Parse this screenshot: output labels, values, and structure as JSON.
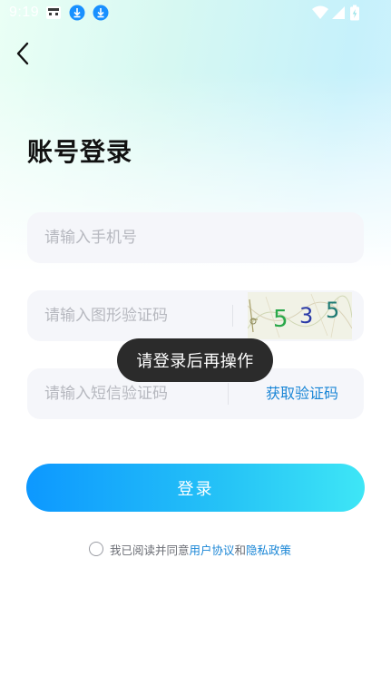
{
  "status_bar": {
    "time": "9:19",
    "icons": [
      "app-badge-icon",
      "download-icon",
      "download-icon",
      "wifi-icon",
      "cellular-signal-icon",
      "battery-icon"
    ]
  },
  "header": {
    "back_icon": "chevron-left-icon"
  },
  "page": {
    "title": "账号登录"
  },
  "form": {
    "phone": {
      "value": "",
      "placeholder": "请输入手机号"
    },
    "captcha": {
      "value": "",
      "placeholder": "请输入图形验证码",
      "image_text": "535"
    },
    "sms": {
      "value": "",
      "placeholder": "请输入短信验证码",
      "get_code_label": "获取验证码"
    }
  },
  "toast": {
    "text": "请登录后再操作"
  },
  "login_button": {
    "label": "登录"
  },
  "agreement": {
    "checked": false,
    "prefix": "我已阅读并同意",
    "user_agreement": "用户协议",
    "conjunction": "和",
    "privacy_policy": "隐私政策"
  },
  "colors": {
    "accent": "#1a86d6",
    "button_start": "#0d98ff",
    "button_end": "#3ee6f6",
    "field_bg": "#f5f6fa",
    "toast_bg": "#2b2b2b"
  }
}
